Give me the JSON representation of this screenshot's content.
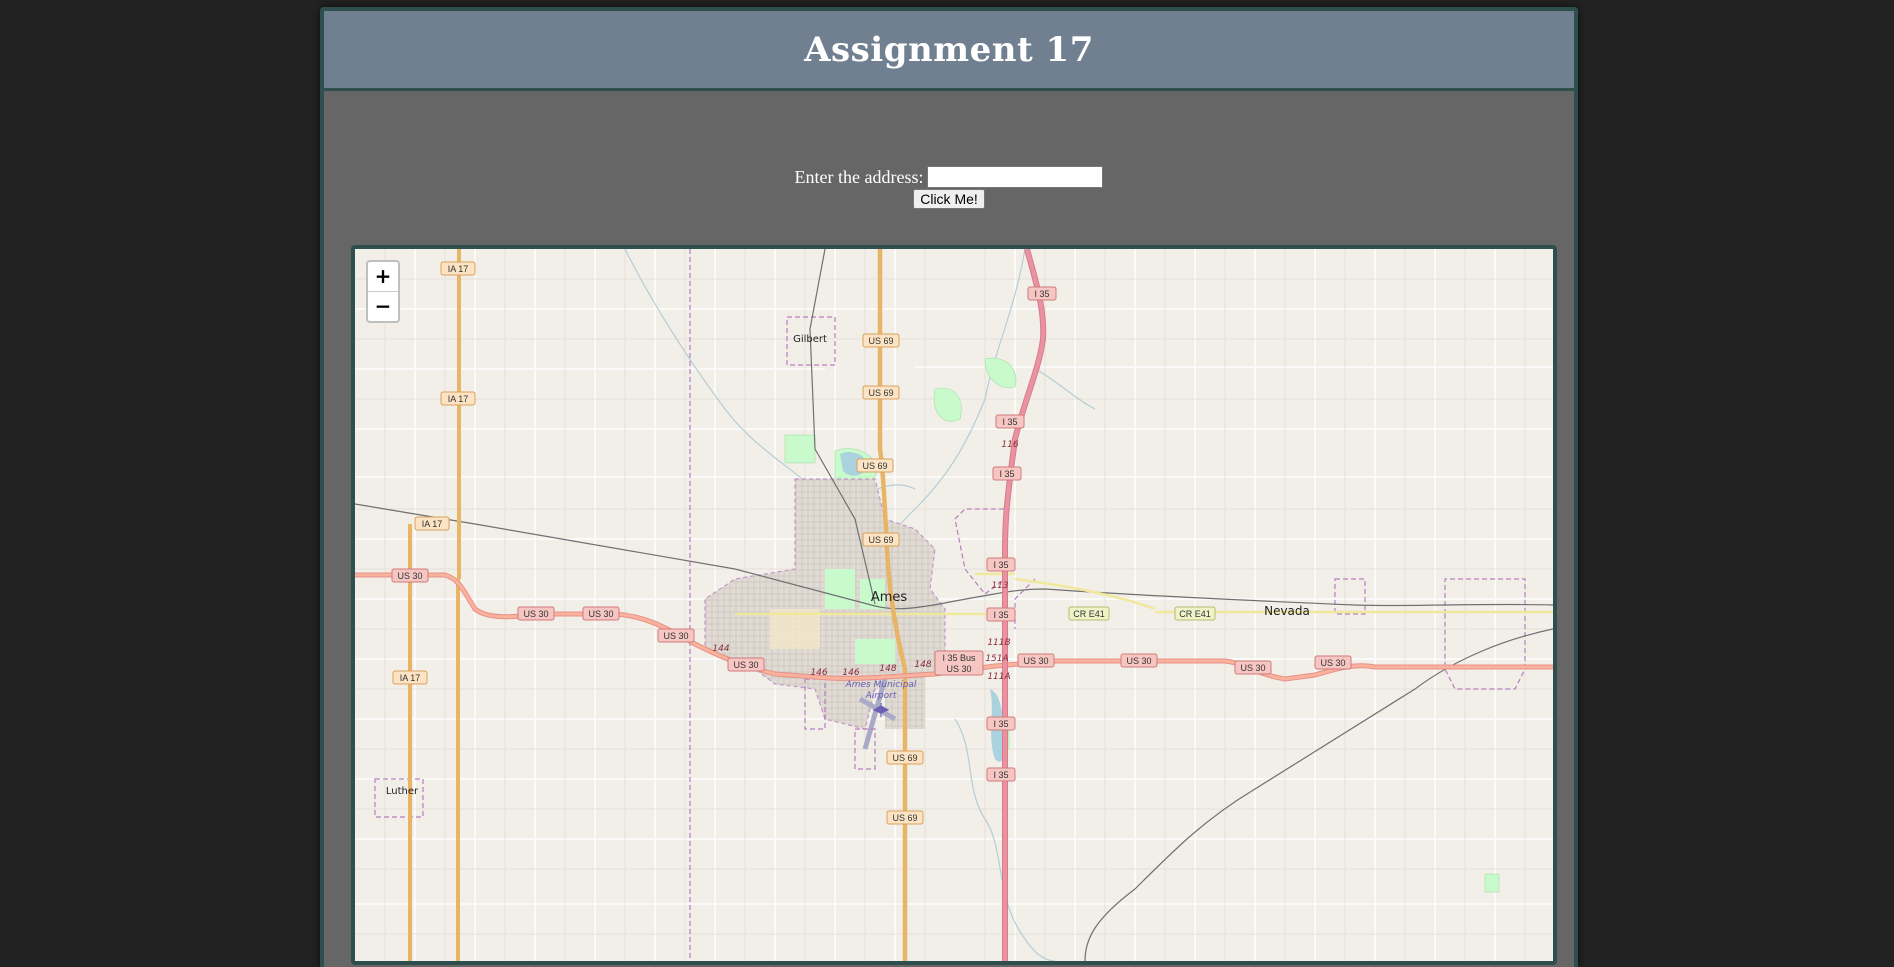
{
  "page": {
    "title": "Assignment 17"
  },
  "form": {
    "label": "Enter the address:",
    "input_value": "",
    "button_label": "Click Me!"
  },
  "map": {
    "zoom_in": "+",
    "zoom_out": "−",
    "places": {
      "ames": "Ames",
      "nevada": "Nevada",
      "gilbert": "Gilbert",
      "luther": "Luther",
      "airport_line1": "Ames Municipal",
      "airport_line2": "Airport"
    },
    "shields": {
      "us69": "US 69",
      "us30": "US 30",
      "i35": "I 35",
      "ia17": "IA 17",
      "cre41": "CR E41",
      "i35bus": "I 35 Bus",
      "us30b": "US 30"
    },
    "exits": [
      "116",
      "113",
      "111B",
      "151A",
      "111A",
      "144",
      "146",
      "146",
      "148",
      "148"
    ],
    "colors": {
      "land": "#f2efe9",
      "motorway": "#e892a2",
      "trunk": "#f9b29c",
      "primary": "#fcd6a4",
      "secondary": "#f7fabf",
      "boundary": "#b77ec0",
      "park": "#c8facc",
      "urban": "#d9d0c9",
      "water": "#aad3df"
    }
  }
}
